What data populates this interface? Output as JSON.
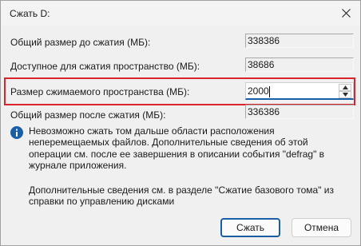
{
  "window": {
    "title": "Сжать D:"
  },
  "fields": [
    {
      "label": "Общий размер до сжатия (МБ):",
      "value": "338386"
    },
    {
      "label": "Доступное для сжатия пространство (МБ):",
      "value": "38686"
    },
    {
      "label": "Общий размер после сжатия (МБ):",
      "value": "336386"
    }
  ],
  "shrink": {
    "label": "Размер сжимаемого пространства (МБ):",
    "value": "2000"
  },
  "info": {
    "text": "Невозможно сжать том дальше области расположения неперемещаемых файлов. Дополнительные сведения об этой операции см. после ее завершения в описании события \"defrag\" в журнале приложения.",
    "more": "Дополнительные сведения см. в разделе \"Сжатие базового тома\" из справки по управлению дисками"
  },
  "buttons": {
    "ok": "Сжать",
    "cancel": "Отмена"
  },
  "colors": {
    "highlight": "#d9242b",
    "accent": "#1a5ea8",
    "info_icon": "#1a5ea8"
  }
}
